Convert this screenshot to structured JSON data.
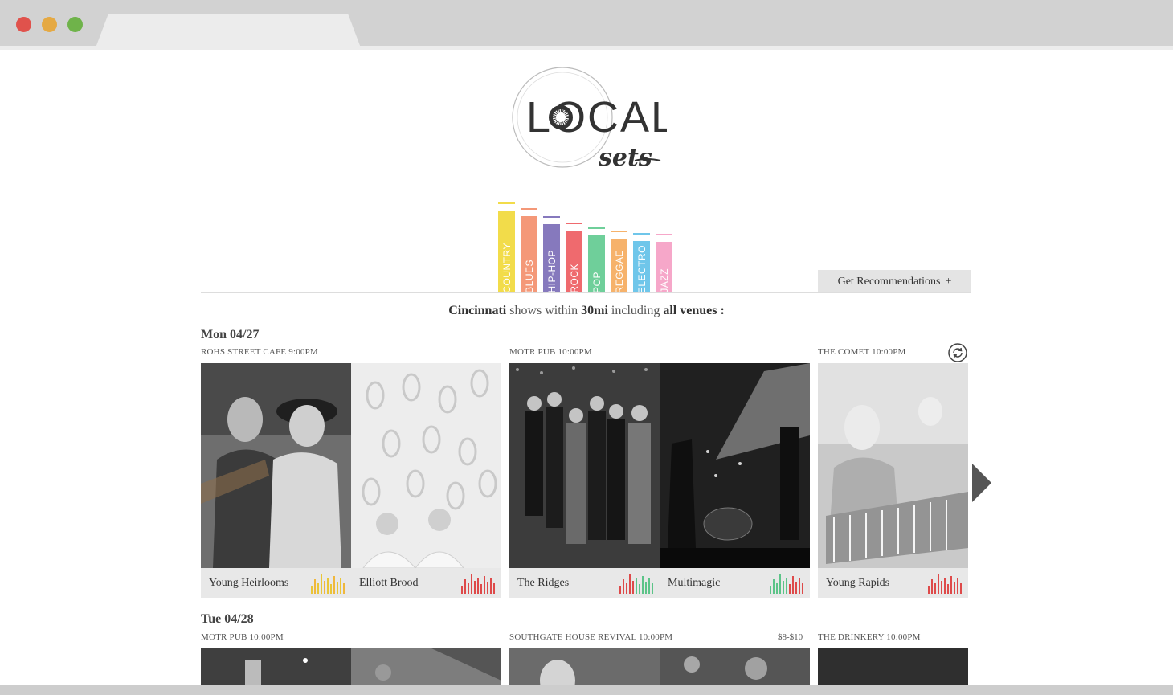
{
  "browser": {
    "dots": [
      "#e0524c",
      "#e5a943",
      "#6fb34a"
    ]
  },
  "logo": {
    "word": "LOCAL",
    "script": "sets"
  },
  "genres": [
    {
      "label": "COUNTRY",
      "color": "#f2dc4a",
      "level": 0.86
    },
    {
      "label": "BLUES",
      "color": "#f49878",
      "level": 0.8
    },
    {
      "label": "HIP-HOP",
      "color": "#8679bd",
      "level": 0.72
    },
    {
      "label": "ROCK",
      "color": "#ef6a6e",
      "level": 0.65
    },
    {
      "label": "POP",
      "color": "#6fcf9a",
      "level": 0.6
    },
    {
      "label": "REGGAE",
      "color": "#f6b26b",
      "level": 0.57
    },
    {
      "label": "ELECTRO",
      "color": "#6fc6ea",
      "level": 0.54
    },
    {
      "label": "JAZZ",
      "color": "#f6a7c9",
      "level": 0.53
    }
  ],
  "recommend": {
    "label": "Get Recommendations",
    "icon": "+"
  },
  "summary": {
    "city": "Cincinnati",
    "t1": "shows within",
    "radius": "30mi",
    "t2": "including",
    "venues": "all venues",
    "t3": ":"
  },
  "days": [
    {
      "date": "Mon 04/27",
      "shows": [
        {
          "venue": "ROHS STREET CAFE 9:00PM",
          "price": "",
          "acts": [
            {
              "name": "Young Heirlooms",
              "eq_color": "#e9c637"
            },
            {
              "name": "Elliott Brood",
              "eq_color": "#de4a4a"
            }
          ]
        },
        {
          "venue": "MOTR PUB 10:00PM",
          "price": "",
          "acts": [
            {
              "name": "The Ridges",
              "eq_color": "mixed"
            },
            {
              "name": "Multimagic",
              "eq_color": "mixed"
            }
          ]
        },
        {
          "venue": "THE COMET 10:00PM",
          "price": "",
          "acts": [
            {
              "name": "Young Rapids",
              "eq_color": "#de4a4a"
            }
          ]
        }
      ]
    },
    {
      "date": "Tue 04/28",
      "shows": [
        {
          "venue": "MOTR PUB 10:00PM",
          "price": ""
        },
        {
          "venue": "SOUTHGATE HOUSE REVIVAL 10:00PM",
          "price": "$8-$10"
        },
        {
          "venue": "THE DRINKERY 10:00PM",
          "price": ""
        }
      ]
    }
  ],
  "icons": {
    "refresh": "refresh-icon",
    "next": "chevron-right-icon"
  }
}
